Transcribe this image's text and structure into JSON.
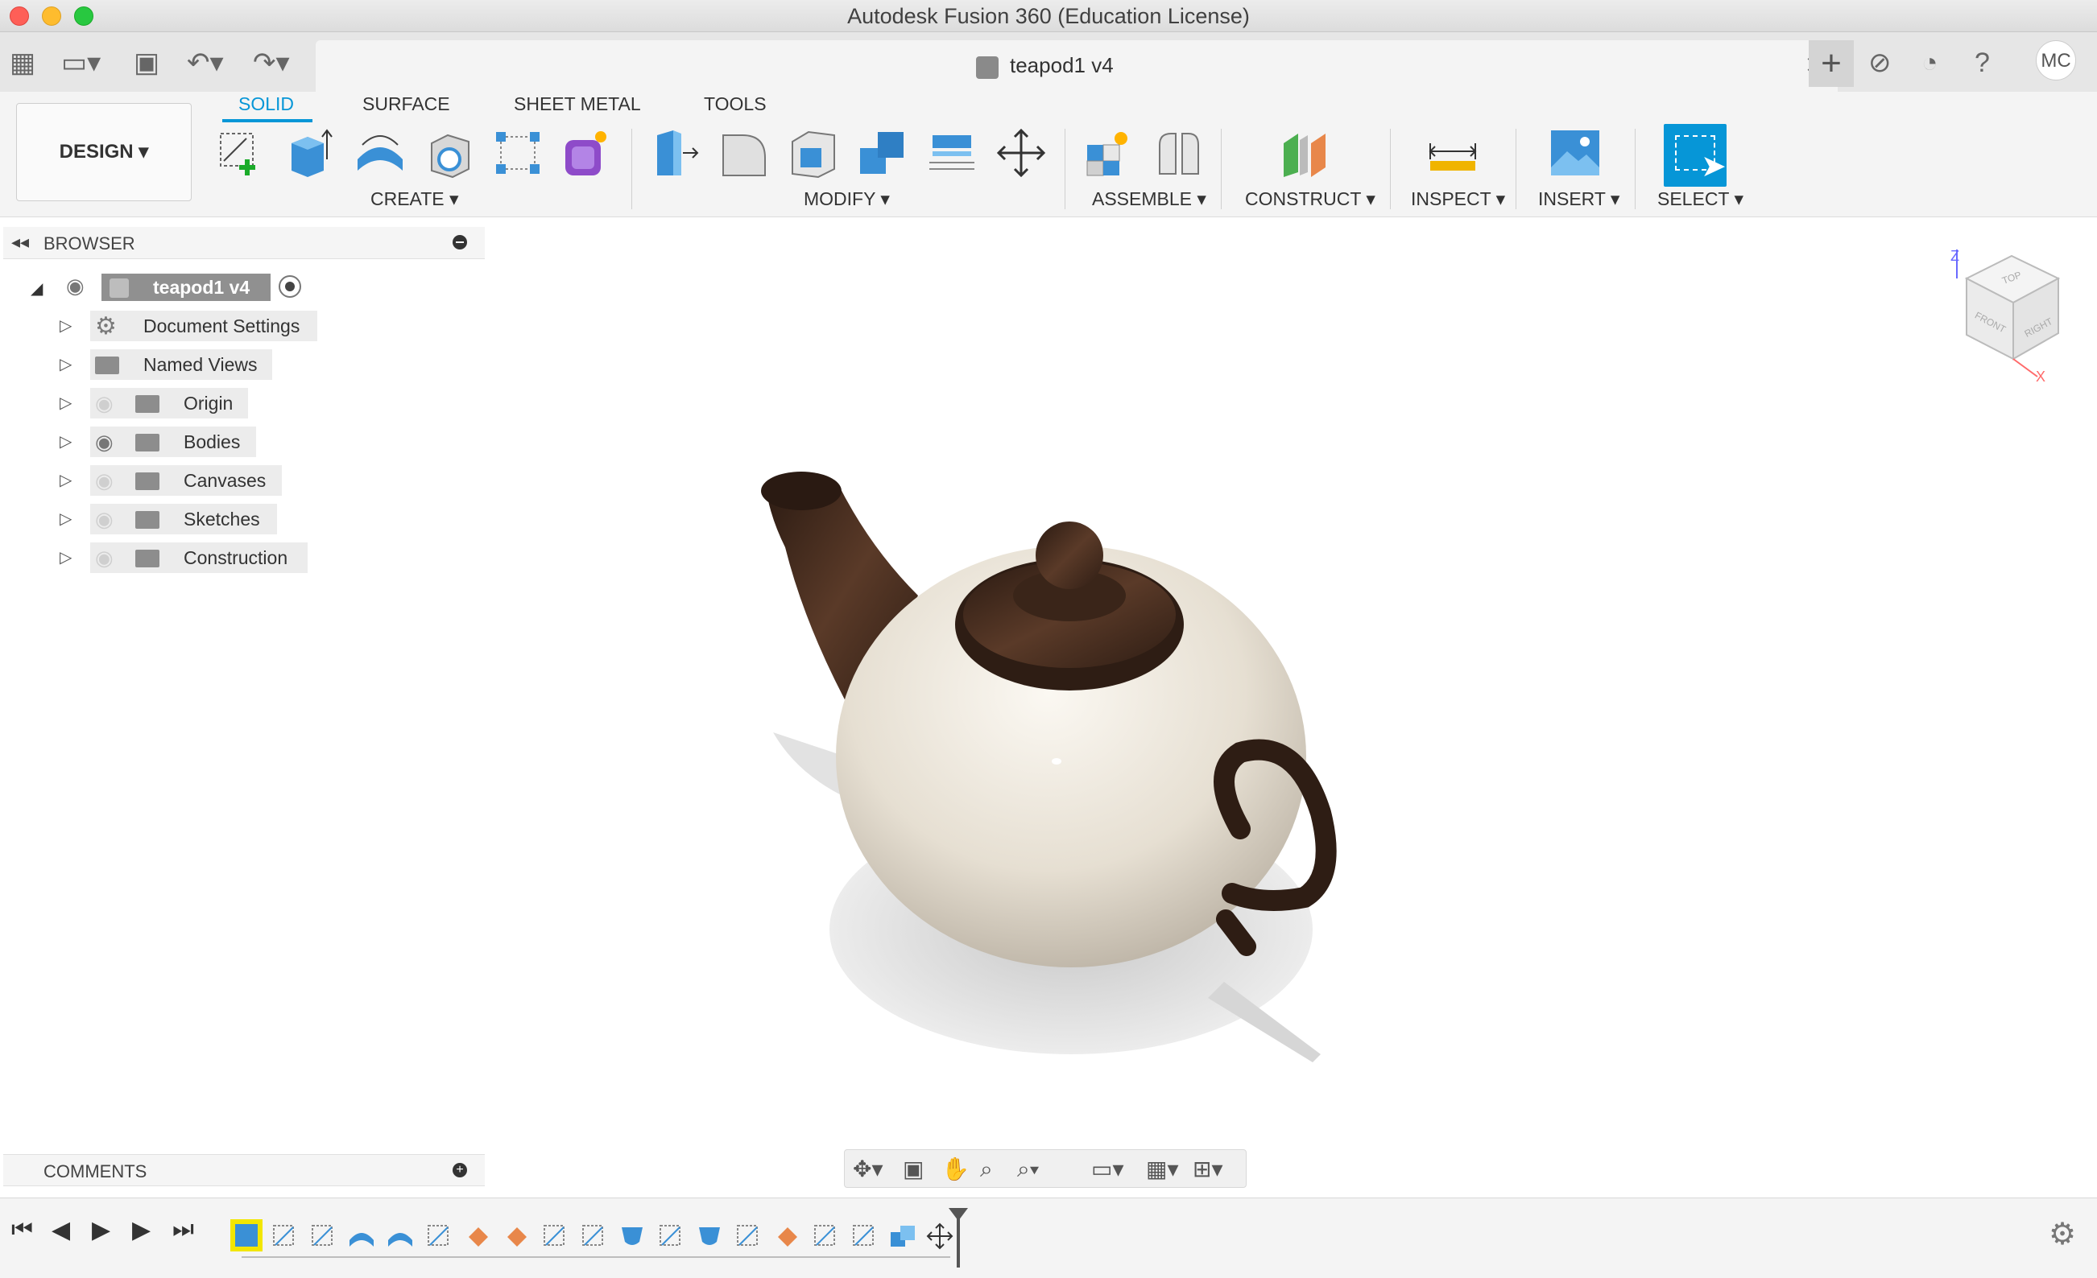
{
  "window": {
    "title": "Autodesk Fusion 360 (Education License)"
  },
  "document_tab": {
    "name": "teapod1 v4",
    "close_glyph": "✕"
  },
  "user": {
    "initials": "MC"
  },
  "workspace": {
    "label": "DESIGN ▾"
  },
  "toolbar_tabs": [
    "SOLID",
    "SURFACE",
    "SHEET METAL",
    "TOOLS"
  ],
  "toolbar_groups": [
    "CREATE ▾",
    "MODIFY ▾",
    "ASSEMBLE ▾",
    "CONSTRUCT ▾",
    "INSPECT ▾",
    "INSERT ▾",
    "SELECT ▾"
  ],
  "browser": {
    "title": "BROWSER",
    "root": "teapod1 v4",
    "items": [
      {
        "label": "Document Settings",
        "icon": "gear-icon",
        "visible": null
      },
      {
        "label": "Named Views",
        "icon": "folder-icon",
        "visible": null
      },
      {
        "label": "Origin",
        "icon": "folder-icon",
        "visible": false
      },
      {
        "label": "Bodies",
        "icon": "folder-icon",
        "visible": true
      },
      {
        "label": "Canvases",
        "icon": "folder-icon",
        "visible": false
      },
      {
        "label": "Sketches",
        "icon": "folder-icon",
        "visible": false
      },
      {
        "label": "Construction",
        "icon": "folder-icon",
        "visible": false
      }
    ]
  },
  "comments": {
    "title": "COMMENTS"
  },
  "viewcube": {
    "top": "TOP",
    "front": "FRONT",
    "right": "RIGHT",
    "z": "Z",
    "x": "X"
  },
  "colors": {
    "accent": "#0696d7",
    "porcelain": "#ece6da",
    "wood": "#3f2a20"
  }
}
